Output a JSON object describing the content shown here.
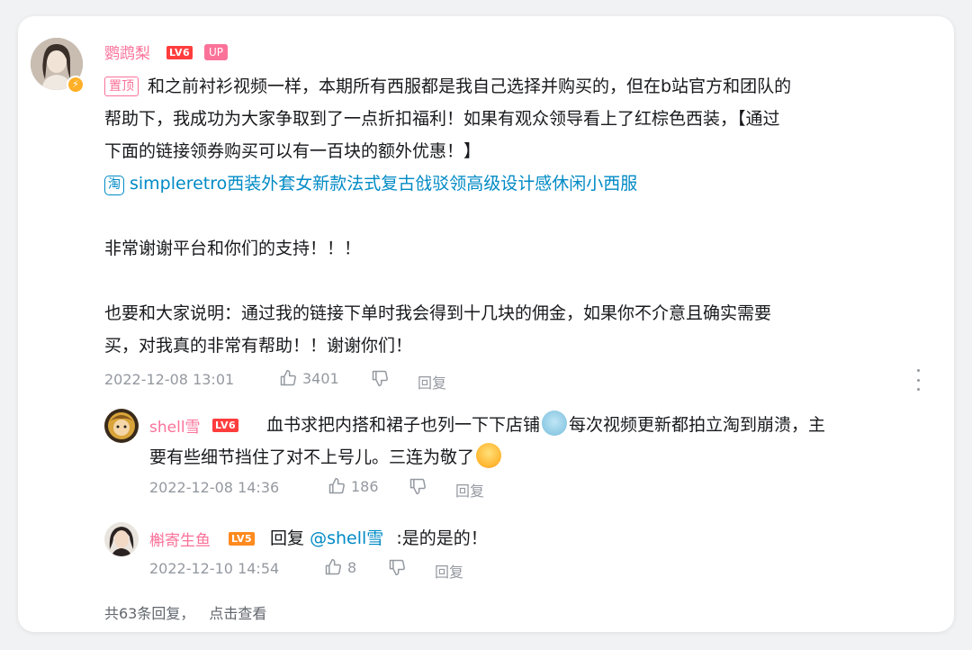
{
  "main_comment": {
    "username": "鹦鹉梨",
    "level": "LV6",
    "up_badge": "UP",
    "pin_tag": "置顶",
    "lines": [
      "和之前衬衫视频一样，本期所有西服都是我自己选择并购买的，但在b站官方和团队的",
      "帮助下，我成功为大家争取到了一点折扣福利！如果有观众领导看上了红棕色西装，【通过",
      "下面的链接领券购买可以有一百块的额外优惠！】"
    ],
    "link_icon": "淘",
    "link_text": "simpleretro西装外套女新款法式复古戗驳领高级设计感休闲小西服",
    "line_thanks": "非常谢谢平台和你们的支持！！！",
    "line_disclose_1": "也要和大家说明：通过我的链接下单时我会得到十几块的佣金，如果你不介意且确实需要",
    "line_disclose_2": "买，对我真的非常有帮助！！谢谢你们！",
    "timestamp": "2022-12-08 13:01",
    "likes": "3401",
    "reply_label": "回复"
  },
  "replies": [
    {
      "username": "shell雪",
      "level": "LV6",
      "text_1_before": "血书求把内搭和裙子也列一下下店铺",
      "text_1_after": "每次视频更新都拍立淘到崩溃，主",
      "text_2": "要有些细节挡住了对不上号儿。三连为敬了",
      "timestamp": "2022-12-08 14:36",
      "likes": "186",
      "reply_label": "回复"
    },
    {
      "username": "槲寄生鱼",
      "level": "LV5",
      "reply_prefix": "回复",
      "mention": "@shell雪",
      "text": ":是的是的！",
      "timestamp": "2022-12-10 14:54",
      "likes": "8",
      "reply_label": "回复"
    }
  ],
  "footer": {
    "count_text": "共63条回复，",
    "view_link": "点击查看"
  },
  "icons": {
    "like": "thumbs-up-icon",
    "dislike": "thumbs-down-icon",
    "more": "more-vertical-icon"
  },
  "colors": {
    "username": "#fb7299",
    "link": "#008ac5",
    "meta": "#9499a0"
  }
}
